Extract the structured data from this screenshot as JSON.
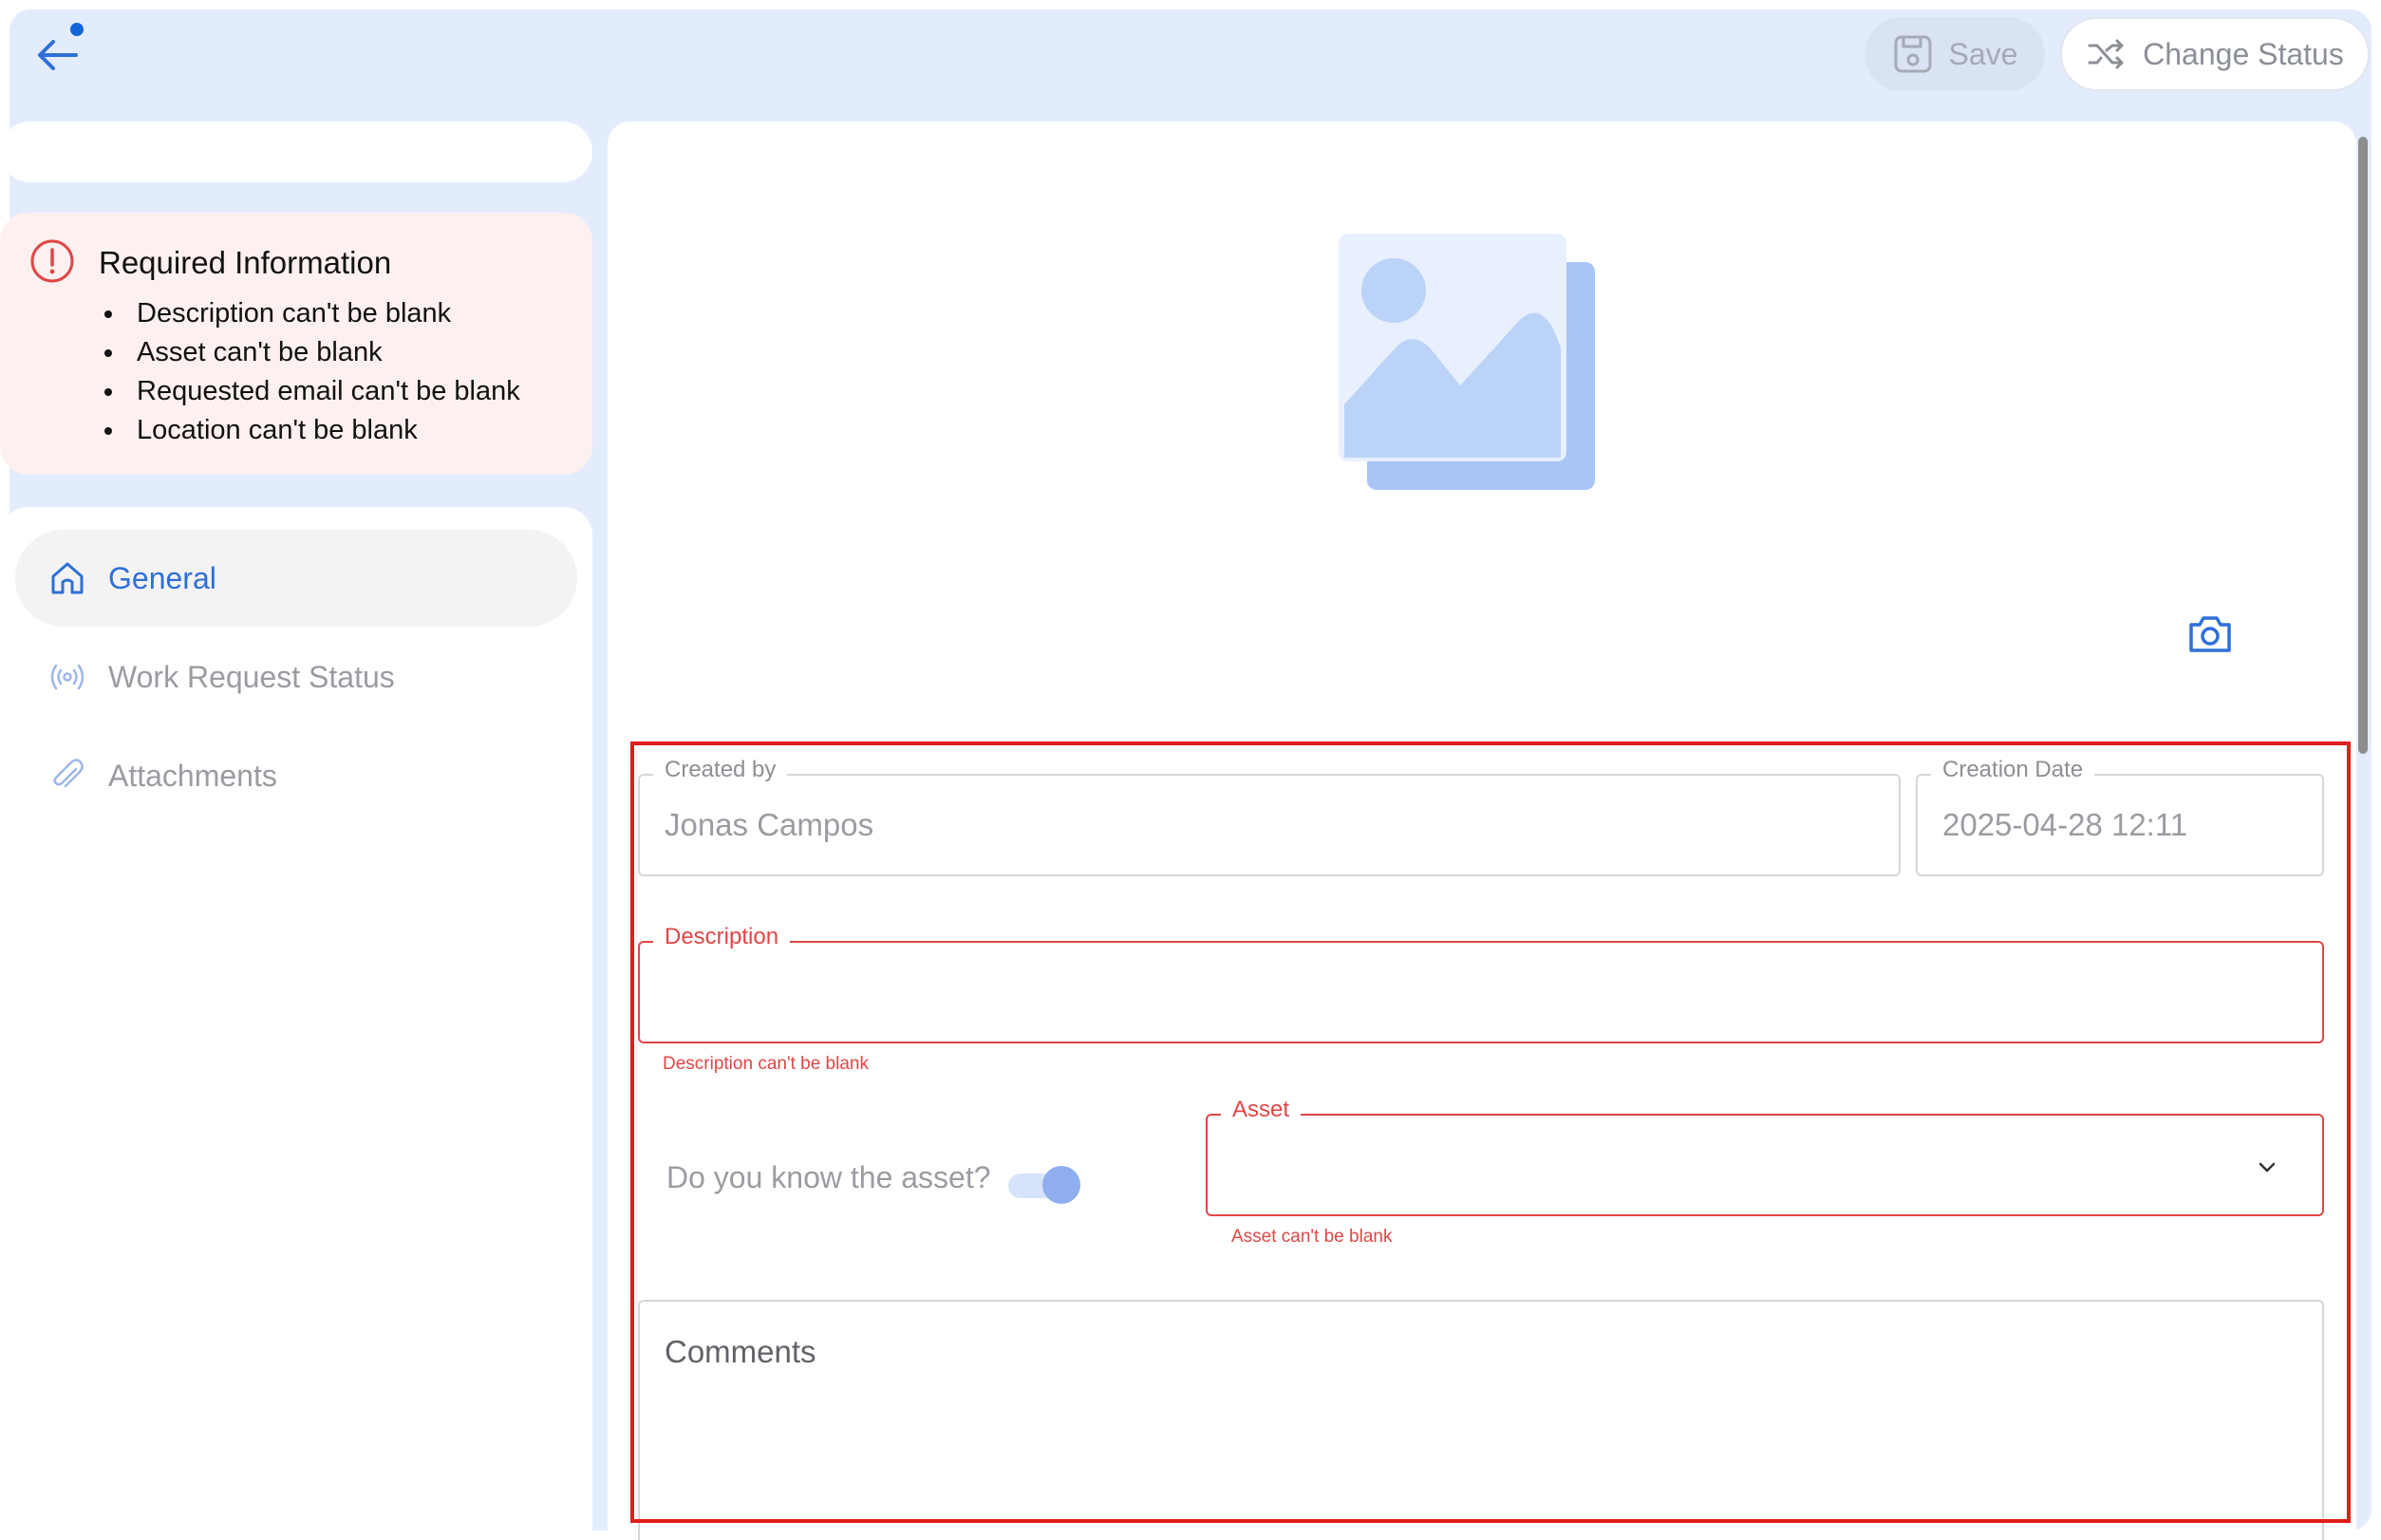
{
  "toolbar": {
    "save_label": "Save",
    "change_status_label": "Change Status"
  },
  "required_info": {
    "title": "Required Information",
    "items": [
      "Description can't be blank",
      "Asset can't be blank",
      "Requested email can't be blank",
      "Location can't be blank"
    ]
  },
  "nav": {
    "items": [
      {
        "label": "General",
        "icon": "home-icon",
        "active": true
      },
      {
        "label": "Work Request Status",
        "icon": "broadcast-icon",
        "active": false
      },
      {
        "label": "Attachments",
        "icon": "paperclip-icon",
        "active": false
      }
    ]
  },
  "form": {
    "created_by": {
      "label": "Created by",
      "value": "Jonas Campos"
    },
    "creation_date": {
      "label": "Creation Date",
      "value": "2025-04-28 12:11"
    },
    "description": {
      "label": "Description",
      "value": "",
      "error": "Description can't be blank"
    },
    "asset_toggle": {
      "label": "Do you know the asset?",
      "on": true
    },
    "asset": {
      "label": "Asset",
      "value": "",
      "error": "Asset can't be blank"
    },
    "comments": {
      "placeholder": "Comments"
    }
  },
  "colors": {
    "accent": "#2f6fd8",
    "error": "#e04646",
    "background": "#e3ecfd",
    "highlight": "#e31c1c"
  }
}
